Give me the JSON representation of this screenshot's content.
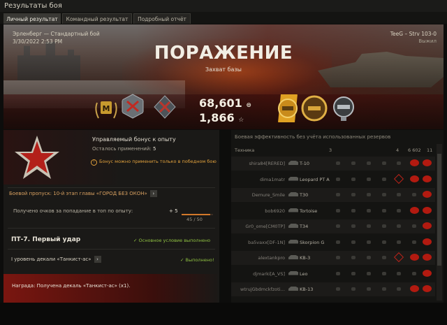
{
  "window": {
    "title": "Результаты боя"
  },
  "tabs": [
    {
      "label": "Личный результат",
      "active": true
    },
    {
      "label": "Командный результат",
      "active": false
    },
    {
      "label": "Подробный отчёт",
      "active": false
    }
  ],
  "battle": {
    "map_mode": "Эрленберг — Стандартный бой",
    "datetime": "3/30/2022 2:53 PM",
    "player_vehicle": "TeeG – Strv 103-0",
    "player_status": "Выжил",
    "result": "ПОРАЖЕНИЕ",
    "result_reason": "Захват базы",
    "credits": "68,601",
    "experience": "1,866",
    "credits_icon": "silver-coin-icon",
    "xp_icon": "star-icon"
  },
  "bonus": {
    "title": "Управляемый бонус к опыту",
    "remaining_label": "Осталось применений:",
    "remaining_value": "5",
    "note": "Бонус можно применить только в победном бою"
  },
  "battle_pass": {
    "label": "Боевой пропуск: 10-й этап главы «ГОРОД БЕЗ ОКОН»",
    "points_label": "Получено очков за попадание в топ по опыту:",
    "points_value": "+ 5",
    "progress_text": "45 / 50",
    "progress_fraction": 0.9
  },
  "mission": {
    "title": "ПТ-7. Первый удар",
    "status": "✓ Основное условие выполнено",
    "decal_label": "I уровень декали «Танкист-ас»",
    "decal_status": "✓ Выполнено!",
    "reward": "Награда:  Получена декаль «Танкист-ас» (x1)."
  },
  "efficiency": {
    "title": "Боевая эффективность без учёта использованных резервов",
    "header_vehicle": "Техника",
    "header_cols": [
      "3",
      "4",
      "6 602",
      "11"
    ],
    "rows": [
      {
        "player": "shira84[RERED]",
        "tank": "T-10",
        "spotted": false,
        "damage": "1"
      },
      {
        "player": "dima1matr",
        "tank": "Leopard PT A",
        "spotted": true,
        "damage": "1"
      },
      {
        "player": "Demure_Smile",
        "tank": "T30",
        "spotted": false,
        "damage": ""
      },
      {
        "player": "bob6920",
        "tank": "Tortoise",
        "spotted": false,
        "damage": "1"
      },
      {
        "player": "Gr0_ome[CM0TP]",
        "tank": "T34",
        "spotted": false,
        "damage": ""
      },
      {
        "player": "ba5vaxx[DF-1N]",
        "tank": "Skorpion G",
        "spotted": false,
        "damage": ""
      },
      {
        "player": "alextankpro",
        "tank": "KB-3",
        "spotted": true,
        "damage": "1"
      },
      {
        "player": "djmarki[A_VS]",
        "tank": "Leo",
        "spotted": false,
        "damage": ""
      },
      {
        "player": "wtrujGbdmckfzoti…",
        "tank": "KB-13",
        "spotted": false,
        "damage": "2"
      }
    ]
  },
  "colors": {
    "accent_red": "#b21a10",
    "ok_green": "#8fc042",
    "warn_orange": "#e2a23d"
  }
}
